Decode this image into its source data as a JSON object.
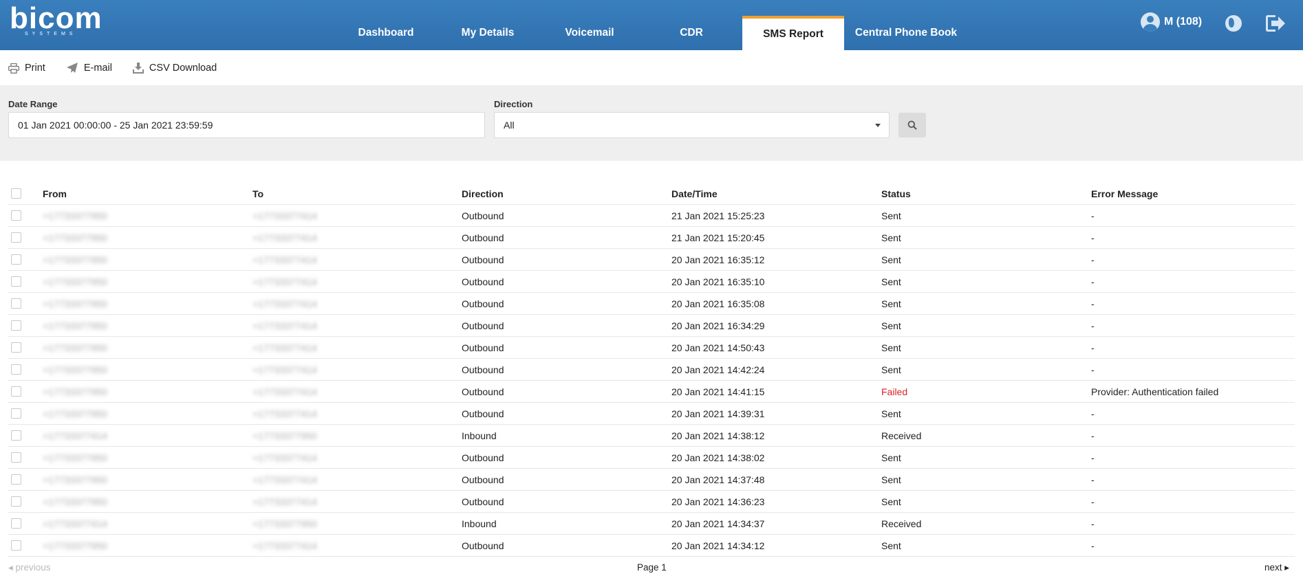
{
  "brand": {
    "name": "bicom",
    "subtitle": "SYSTEMS"
  },
  "nav": {
    "tabs": [
      {
        "label": "Dashboard"
      },
      {
        "label": "My Details"
      },
      {
        "label": "Voicemail"
      },
      {
        "label": "CDR"
      },
      {
        "label": "SMS Report",
        "active": true
      },
      {
        "label": "Central Phone Book"
      }
    ]
  },
  "user": {
    "label": "M (108)"
  },
  "toolbar": {
    "print": "Print",
    "email": "E-mail",
    "csv": "CSV Download"
  },
  "filter": {
    "date_range_label": "Date Range",
    "date_range_value": "01 Jan 2021 00:00:00 - 25 Jan 2021 23:59:59",
    "direction_label": "Direction",
    "direction_value": "All"
  },
  "table": {
    "headers": {
      "from": "From",
      "to": "To",
      "direction": "Direction",
      "datetime": "Date/Time",
      "status": "Status",
      "error": "Error Message"
    },
    "rows": [
      {
        "from": "+17733377950",
        "to": "+17733377414",
        "direction": "Outbound",
        "datetime": "21 Jan 2021 15:25:23",
        "status": "Sent",
        "error": "-"
      },
      {
        "from": "+17733377950",
        "to": "+17733377414",
        "direction": "Outbound",
        "datetime": "21 Jan 2021 15:20:45",
        "status": "Sent",
        "error": "-"
      },
      {
        "from": "+17733377950",
        "to": "+17733377414",
        "direction": "Outbound",
        "datetime": "20 Jan 2021 16:35:12",
        "status": "Sent",
        "error": "-"
      },
      {
        "from": "+17733377950",
        "to": "+17733377414",
        "direction": "Outbound",
        "datetime": "20 Jan 2021 16:35:10",
        "status": "Sent",
        "error": "-"
      },
      {
        "from": "+17733377950",
        "to": "+17733377414",
        "direction": "Outbound",
        "datetime": "20 Jan 2021 16:35:08",
        "status": "Sent",
        "error": "-"
      },
      {
        "from": "+17733377950",
        "to": "+17733377414",
        "direction": "Outbound",
        "datetime": "20 Jan 2021 16:34:29",
        "status": "Sent",
        "error": "-"
      },
      {
        "from": "+17733377950",
        "to": "+17733377414",
        "direction": "Outbound",
        "datetime": "20 Jan 2021 14:50:43",
        "status": "Sent",
        "error": "-"
      },
      {
        "from": "+17733377950",
        "to": "+17733377414",
        "direction": "Outbound",
        "datetime": "20 Jan 2021 14:42:24",
        "status": "Sent",
        "error": "-"
      },
      {
        "from": "+17733377950",
        "to": "+17733377414",
        "direction": "Outbound",
        "datetime": "20 Jan 2021 14:41:15",
        "status": "Failed",
        "error": "Provider: Authentication failed"
      },
      {
        "from": "+17733377950",
        "to": "+17733377414",
        "direction": "Outbound",
        "datetime": "20 Jan 2021 14:39:31",
        "status": "Sent",
        "error": "-"
      },
      {
        "from": "+17733377414",
        "to": "+17733377950",
        "direction": "Inbound",
        "datetime": "20 Jan 2021 14:38:12",
        "status": "Received",
        "error": "-"
      },
      {
        "from": "+17733377950",
        "to": "+17733377414",
        "direction": "Outbound",
        "datetime": "20 Jan 2021 14:38:02",
        "status": "Sent",
        "error": "-"
      },
      {
        "from": "+17733377950",
        "to": "+17733377414",
        "direction": "Outbound",
        "datetime": "20 Jan 2021 14:37:48",
        "status": "Sent",
        "error": "-"
      },
      {
        "from": "+17733377950",
        "to": "+17733377414",
        "direction": "Outbound",
        "datetime": "20 Jan 2021 14:36:23",
        "status": "Sent",
        "error": "-"
      },
      {
        "from": "+17733377414",
        "to": "+17733377950",
        "direction": "Inbound",
        "datetime": "20 Jan 2021 14:34:37",
        "status": "Received",
        "error": "-"
      },
      {
        "from": "+17733377950",
        "to": "+17733377414",
        "direction": "Outbound",
        "datetime": "20 Jan 2021 14:34:12",
        "status": "Sent",
        "error": "-"
      }
    ]
  },
  "pager": {
    "previous": "previous",
    "page": "Page 1",
    "next": "next"
  },
  "colors": {
    "header": "#2f6fae",
    "active_tab_accent": "#f0a030",
    "failed": "#d9222a"
  }
}
